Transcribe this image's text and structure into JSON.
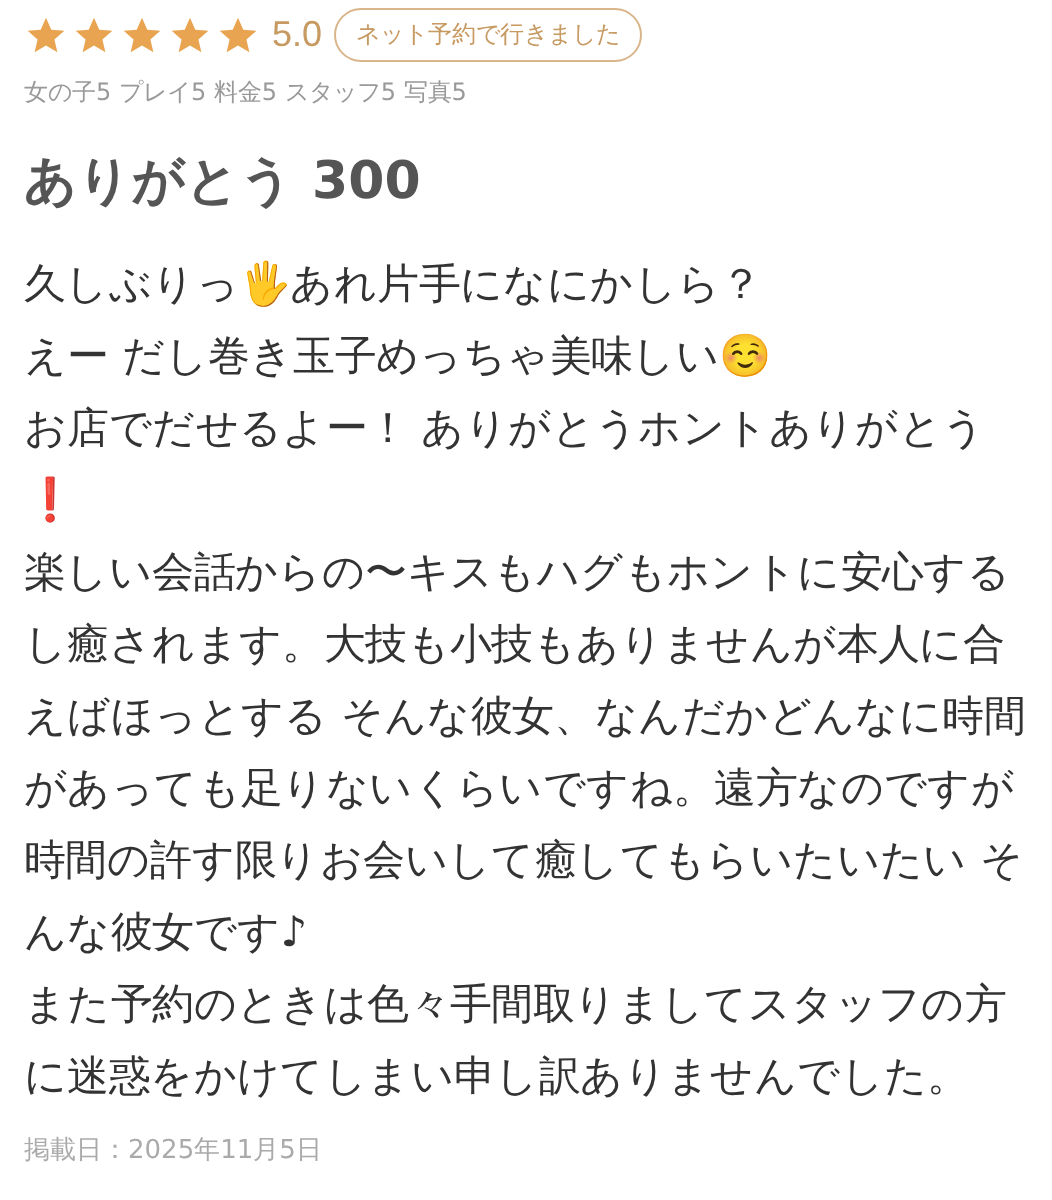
{
  "rating": {
    "stars": 5,
    "score": "5.0",
    "badge": "ネット予約で行きました"
  },
  "sub_scores": "女の子5 プレイ5 料金5 スタッフ5 写真5",
  "title": "ありがとう 300",
  "body": [
    "久しぶりっ🖐あれ片手になにかしら？",
    "えー だし巻き玉子めっちゃ美味しい☺️",
    "お店でだせるよー！ ありがとうホントありがとう❗",
    "楽しい会話からの〜キスもハグもホントに安心するし癒されます。大技も小技もありませんが本人に合えばほっとする そんな彼女、なんだかどんなに時間があっても足りないくらいですね。遠方なのですが時間の許す限りお会いして癒してもらいたいたい そんな彼女です♪",
    "また予約のときは色々手間取りましてスタッフの方に迷惑をかけてしまい申し訳ありませんでした。"
  ],
  "posted": "掲載日：2025年11月5日"
}
